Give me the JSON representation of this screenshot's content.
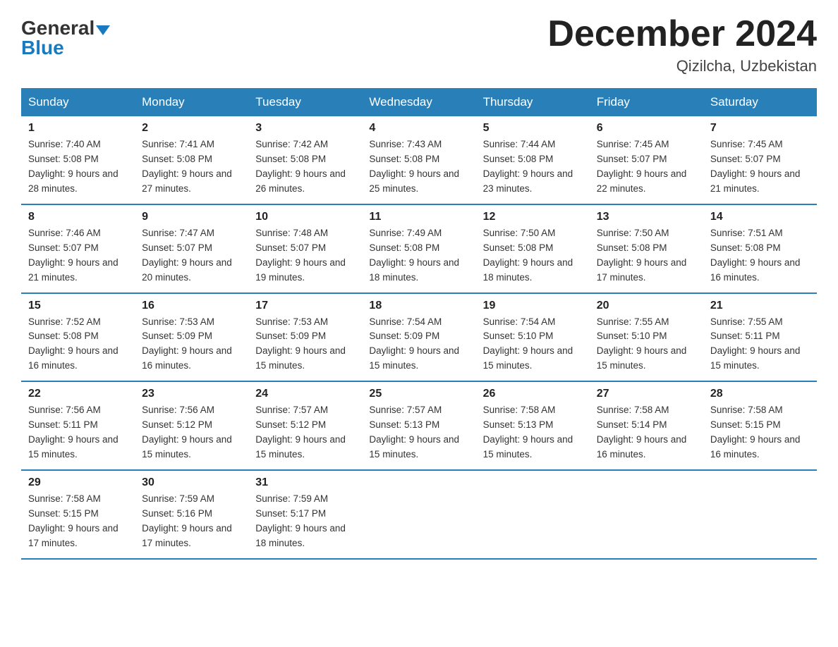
{
  "header": {
    "logo_general": "General",
    "logo_blue": "Blue",
    "month_title": "December 2024",
    "location": "Qizilcha, Uzbekistan"
  },
  "weekdays": [
    "Sunday",
    "Monday",
    "Tuesday",
    "Wednesday",
    "Thursday",
    "Friday",
    "Saturday"
  ],
  "weeks": [
    [
      {
        "day": "1",
        "sunrise": "7:40 AM",
        "sunset": "5:08 PM",
        "daylight": "9 hours and 28 minutes."
      },
      {
        "day": "2",
        "sunrise": "7:41 AM",
        "sunset": "5:08 PM",
        "daylight": "9 hours and 27 minutes."
      },
      {
        "day": "3",
        "sunrise": "7:42 AM",
        "sunset": "5:08 PM",
        "daylight": "9 hours and 26 minutes."
      },
      {
        "day": "4",
        "sunrise": "7:43 AM",
        "sunset": "5:08 PM",
        "daylight": "9 hours and 25 minutes."
      },
      {
        "day": "5",
        "sunrise": "7:44 AM",
        "sunset": "5:08 PM",
        "daylight": "9 hours and 23 minutes."
      },
      {
        "day": "6",
        "sunrise": "7:45 AM",
        "sunset": "5:07 PM",
        "daylight": "9 hours and 22 minutes."
      },
      {
        "day": "7",
        "sunrise": "7:45 AM",
        "sunset": "5:07 PM",
        "daylight": "9 hours and 21 minutes."
      }
    ],
    [
      {
        "day": "8",
        "sunrise": "7:46 AM",
        "sunset": "5:07 PM",
        "daylight": "9 hours and 21 minutes."
      },
      {
        "day": "9",
        "sunrise": "7:47 AM",
        "sunset": "5:07 PM",
        "daylight": "9 hours and 20 minutes."
      },
      {
        "day": "10",
        "sunrise": "7:48 AM",
        "sunset": "5:07 PM",
        "daylight": "9 hours and 19 minutes."
      },
      {
        "day": "11",
        "sunrise": "7:49 AM",
        "sunset": "5:08 PM",
        "daylight": "9 hours and 18 minutes."
      },
      {
        "day": "12",
        "sunrise": "7:50 AM",
        "sunset": "5:08 PM",
        "daylight": "9 hours and 18 minutes."
      },
      {
        "day": "13",
        "sunrise": "7:50 AM",
        "sunset": "5:08 PM",
        "daylight": "9 hours and 17 minutes."
      },
      {
        "day": "14",
        "sunrise": "7:51 AM",
        "sunset": "5:08 PM",
        "daylight": "9 hours and 16 minutes."
      }
    ],
    [
      {
        "day": "15",
        "sunrise": "7:52 AM",
        "sunset": "5:08 PM",
        "daylight": "9 hours and 16 minutes."
      },
      {
        "day": "16",
        "sunrise": "7:53 AM",
        "sunset": "5:09 PM",
        "daylight": "9 hours and 16 minutes."
      },
      {
        "day": "17",
        "sunrise": "7:53 AM",
        "sunset": "5:09 PM",
        "daylight": "9 hours and 15 minutes."
      },
      {
        "day": "18",
        "sunrise": "7:54 AM",
        "sunset": "5:09 PM",
        "daylight": "9 hours and 15 minutes."
      },
      {
        "day": "19",
        "sunrise": "7:54 AM",
        "sunset": "5:10 PM",
        "daylight": "9 hours and 15 minutes."
      },
      {
        "day": "20",
        "sunrise": "7:55 AM",
        "sunset": "5:10 PM",
        "daylight": "9 hours and 15 minutes."
      },
      {
        "day": "21",
        "sunrise": "7:55 AM",
        "sunset": "5:11 PM",
        "daylight": "9 hours and 15 minutes."
      }
    ],
    [
      {
        "day": "22",
        "sunrise": "7:56 AM",
        "sunset": "5:11 PM",
        "daylight": "9 hours and 15 minutes."
      },
      {
        "day": "23",
        "sunrise": "7:56 AM",
        "sunset": "5:12 PM",
        "daylight": "9 hours and 15 minutes."
      },
      {
        "day": "24",
        "sunrise": "7:57 AM",
        "sunset": "5:12 PM",
        "daylight": "9 hours and 15 minutes."
      },
      {
        "day": "25",
        "sunrise": "7:57 AM",
        "sunset": "5:13 PM",
        "daylight": "9 hours and 15 minutes."
      },
      {
        "day": "26",
        "sunrise": "7:58 AM",
        "sunset": "5:13 PM",
        "daylight": "9 hours and 15 minutes."
      },
      {
        "day": "27",
        "sunrise": "7:58 AM",
        "sunset": "5:14 PM",
        "daylight": "9 hours and 16 minutes."
      },
      {
        "day": "28",
        "sunrise": "7:58 AM",
        "sunset": "5:15 PM",
        "daylight": "9 hours and 16 minutes."
      }
    ],
    [
      {
        "day": "29",
        "sunrise": "7:58 AM",
        "sunset": "5:15 PM",
        "daylight": "9 hours and 17 minutes."
      },
      {
        "day": "30",
        "sunrise": "7:59 AM",
        "sunset": "5:16 PM",
        "daylight": "9 hours and 17 minutes."
      },
      {
        "day": "31",
        "sunrise": "7:59 AM",
        "sunset": "5:17 PM",
        "daylight": "9 hours and 18 minutes."
      },
      null,
      null,
      null,
      null
    ]
  ]
}
